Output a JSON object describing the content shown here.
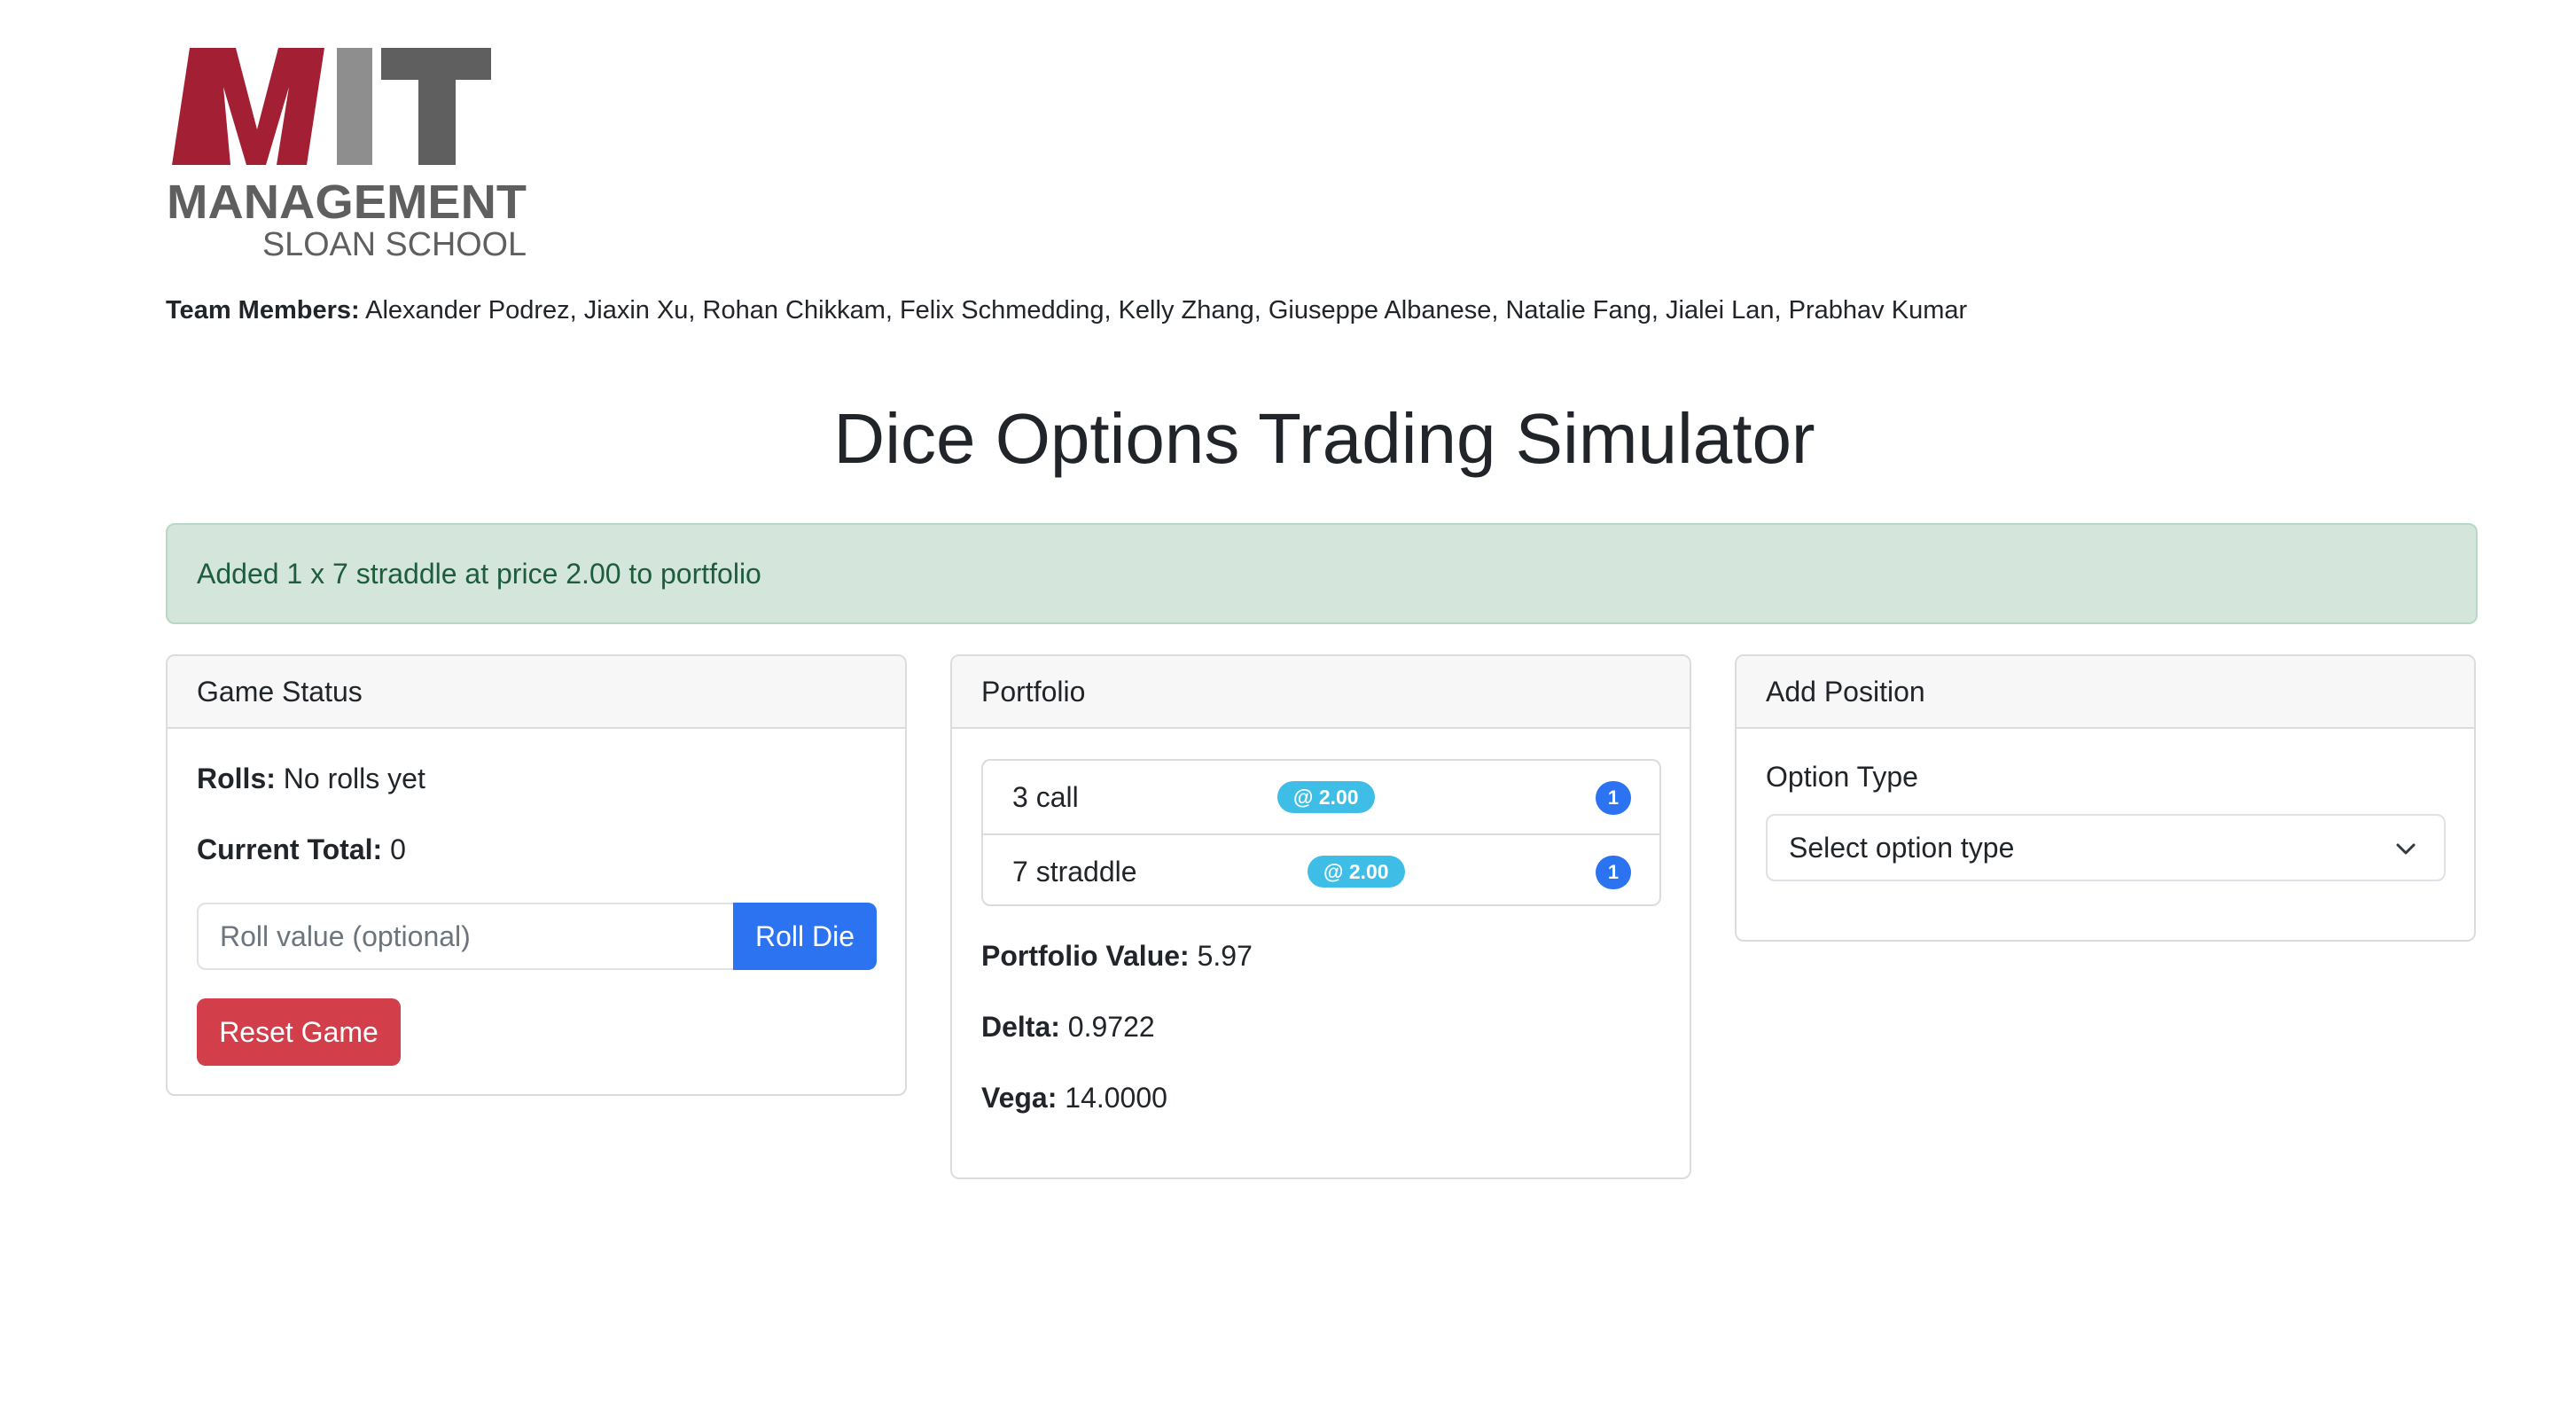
{
  "logo": {
    "letters": "MIT",
    "line1": "MANAGEMENT",
    "line2": "SLOAN SCHOOL",
    "colors": {
      "red": "#a31f34",
      "gray": "#5f5f5f"
    }
  },
  "team": {
    "label": "Team Members:",
    "members": " Alexander Podrez, Jiaxin Xu, Rohan Chikkam, Felix Schmedding, Kelly Zhang, Giuseppe Albanese, Natalie Fang, Jialei Lan, Prabhav Kumar"
  },
  "title": "Dice Options Trading Simulator",
  "alert": {
    "message": "Added 1 x 7 straddle at price 2.00 to portfolio",
    "color": "#d4e6dc"
  },
  "game_status": {
    "header": "Game Status",
    "rolls_label": "Rolls:",
    "rolls_value": " No rolls yet",
    "total_label": "Current Total:",
    "total_value": " 0",
    "roll_input": {
      "placeholder": "Roll value (optional)",
      "value": ""
    },
    "roll_button": "Roll Die",
    "reset_button": "Reset Game"
  },
  "portfolio": {
    "header": "Portfolio",
    "positions": [
      {
        "name": "3 call",
        "price": "@ 2.00",
        "quantity": "1"
      },
      {
        "name": "7 straddle",
        "price": "@ 2.00",
        "quantity": "1"
      }
    ],
    "value_label": "Portfolio Value:",
    "value": " 5.97",
    "delta_label": "Delta:",
    "delta": " 0.9722",
    "vega_label": "Vega:",
    "vega": " 14.0000"
  },
  "add_position": {
    "header": "Add Position",
    "option_type_label": "Option Type",
    "option_type_selected": "Select option type",
    "select_icon": "chevron-down-icon"
  },
  "colors": {
    "primary": "#2b73f0",
    "danger": "#d23f4b",
    "info": "#3ebde6"
  }
}
